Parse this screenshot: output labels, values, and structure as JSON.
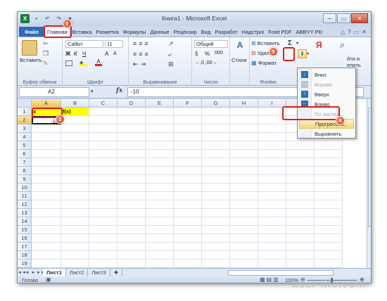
{
  "window": {
    "title": "Книга1 - Microsoft Excel",
    "app_icon": "excel-icon",
    "controls": [
      "─",
      "▭",
      "✕"
    ]
  },
  "tabs": {
    "file": "Файл",
    "items": [
      "Главная",
      "Вставка",
      "Разметка",
      "Формулы",
      "Данные",
      "Рецензир",
      "Вид",
      "Разработ",
      "Надстрої",
      "Foxit PDF",
      "ABBYY PD"
    ],
    "active": "Главная"
  },
  "ribbon": {
    "clipboard": {
      "paste": "Вставить",
      "label": "Буфер обмена"
    },
    "font": {
      "name": "Calibri",
      "size": "11",
      "bold": "Ж",
      "italic": "К",
      "underline": "Ч",
      "grow": "A",
      "shrink": "A",
      "label": "Шрифт"
    },
    "alignment": {
      "label": "Выравнивание"
    },
    "number": {
      "format": "Общий",
      "percent": "%",
      "thousands": "000",
      "label": "Число"
    },
    "styles": {
      "button": "Стили"
    },
    "cells": {
      "insert": "Вставить",
      "delete": "Удалить",
      "format": "Формат",
      "label": "Ячейки"
    },
    "editing": {
      "sigma": "Σ",
      "sort": "Я",
      "find_suffix": "йти и",
      "select_suffix": "елить",
      "label_suffix": "ие"
    }
  },
  "formula_bar": {
    "cell_ref": "A2",
    "fx": "fx",
    "value": "-10"
  },
  "grid": {
    "columns": [
      "A",
      "B",
      "C",
      "D",
      "E",
      "F",
      "G",
      "H",
      "I",
      "J",
      "K"
    ],
    "rows": [
      "1",
      "2",
      "3",
      "4",
      "5",
      "6",
      "7",
      "8",
      "9",
      "10",
      "11",
      "12",
      "13",
      "14",
      "15",
      "16",
      "17",
      "18",
      "19"
    ],
    "cells": {
      "A1": "x",
      "B1": "f(x)",
      "A2": "-10"
    }
  },
  "sheets": {
    "tabs": [
      "Лист1",
      "Лист2",
      "Лист3"
    ],
    "active": "Лист1",
    "nav": [
      "◄◄",
      "◄",
      "►",
      "►►"
    ]
  },
  "status": {
    "text": "Готово",
    "zoom": "100%"
  },
  "fill_menu": {
    "items": [
      {
        "label": "Вниз",
        "icon": "fill-down-icon",
        "enabled": true
      },
      {
        "label": "Вправо",
        "icon": "fill-right-icon",
        "enabled": false
      },
      {
        "label": "Вверх",
        "icon": "fill-up-icon",
        "enabled": true
      },
      {
        "label": "Влево",
        "icon": "fill-left-icon",
        "enabled": true
      },
      {
        "label": "По листам...",
        "icon": "",
        "enabled": false
      },
      {
        "label": "Прогрессия...",
        "icon": "",
        "enabled": true
      },
      {
        "label": "Выровнять",
        "icon": "",
        "enabled": true
      }
    ]
  },
  "callouts": [
    "1",
    "2",
    "3",
    "4"
  ],
  "watermark": "user-life.com",
  "colors": {
    "file_tab": "#2c6eb9",
    "header_yellow": "#ffff00",
    "highlight": "#e21c1c"
  }
}
